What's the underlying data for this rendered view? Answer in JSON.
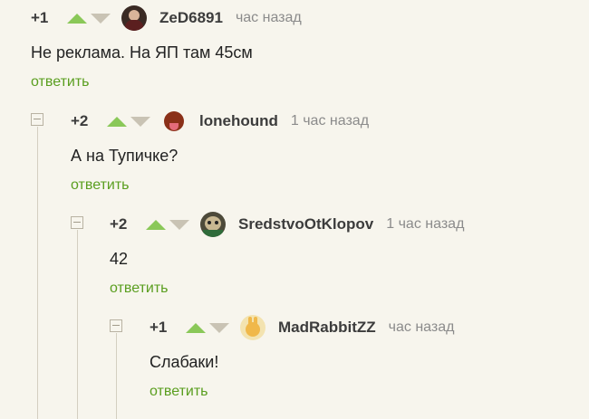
{
  "comments": [
    {
      "rating": "+1",
      "user": "ZeD6891",
      "time": "час назад",
      "text": "Не реклама. На ЯП там 45см",
      "reply": "ответить"
    },
    {
      "rating": "+2",
      "user": "lonehound",
      "time": "1 час назад",
      "text": "А на Тупичке?",
      "reply": "ответить"
    },
    {
      "rating": "+2",
      "user": "SredstvoOtKlopov",
      "time": "1 час назад",
      "text": "42",
      "reply": "ответить"
    },
    {
      "rating": "+1",
      "user": "MadRabbitZZ",
      "time": "час назад",
      "text": "Слабаки!",
      "reply": "ответить"
    }
  ],
  "colors": {
    "background": "#f7f5ed",
    "reply": "#5a9e1f",
    "upvote": "#8ac858",
    "downvote": "#c9c3b4"
  },
  "icons": [
    "collapse-icon",
    "upvote-icon",
    "downvote-icon",
    "avatar"
  ]
}
